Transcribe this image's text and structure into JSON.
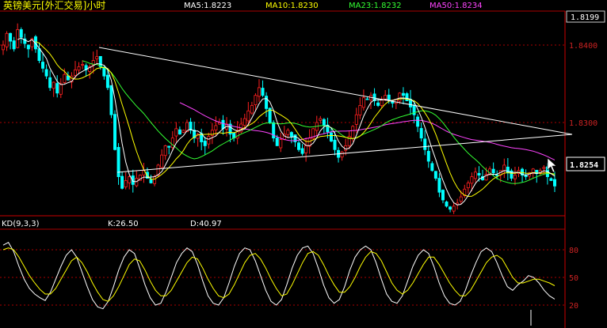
{
  "header": {
    "title": "英镑美元[外汇交易]小时",
    "ma_labels": [
      {
        "text": "MA5:1.8223",
        "color": "#ffffff"
      },
      {
        "text": "MA10:1.8230",
        "color": "#ffff00"
      },
      {
        "text": "MA23:1.8232",
        "color": "#33ff33"
      },
      {
        "text": "MA50:1.8234",
        "color": "#ff44ff"
      }
    ]
  },
  "price_axis": {
    "top_label": "1.8199",
    "ticks": [
      "1.8400",
      "1.8300"
    ],
    "current_price": "1.8254"
  },
  "kd_panel": {
    "title": "KD(9,3,3)",
    "k_label": "K:26.50",
    "d_label": "D:40.97",
    "ticks": [
      "80",
      "50",
      "20"
    ]
  },
  "colors": {
    "background": "#000000",
    "up_candle": "#ff2020",
    "down_candle": "#00ffff",
    "grid": "#aa0000",
    "axis_text": "#cc2222",
    "k_line": "#ffffff",
    "d_line": "#ffff00"
  },
  "icons": [
    "mouse-cursor-icon"
  ],
  "chart_data": [
    {
      "type": "candlestick",
      "title": "英镑美元[外汇交易]小时",
      "ylim": [
        1.8155,
        1.8455
      ],
      "yticks": [
        1.84,
        1.83
      ],
      "ma_values": {
        "MA5": 1.8223,
        "MA10": 1.823,
        "MA23": 1.8232,
        "MA50": 1.8234
      },
      "last_price": 1.8254,
      "close": [
        1.84,
        1.8415,
        1.8405,
        1.8395,
        1.842,
        1.841,
        1.8402,
        1.8395,
        1.8408,
        1.8395,
        1.838,
        1.837,
        1.836,
        1.8345,
        1.8352,
        1.8338,
        1.835,
        1.8362,
        1.8355,
        1.836,
        1.8368,
        1.8372,
        1.8375,
        1.8368,
        1.8372,
        1.838,
        1.8385,
        1.8372,
        1.836,
        1.8345,
        1.831,
        1.8265,
        1.823,
        1.8215,
        1.8225,
        1.823,
        1.822,
        1.8228,
        1.8232,
        1.8238,
        1.8228,
        1.8222,
        1.823,
        1.8245,
        1.8258,
        1.827,
        1.8268,
        1.828,
        1.8292,
        1.8285,
        1.829,
        1.83,
        1.829,
        1.828,
        1.8285,
        1.8275,
        1.827,
        1.8282,
        1.829,
        1.8296,
        1.83,
        1.8292,
        1.8298,
        1.8285,
        1.828,
        1.829,
        1.8298,
        1.8305,
        1.8315,
        1.8322,
        1.8335,
        1.8345,
        1.8335,
        1.8318,
        1.83,
        1.828,
        1.827,
        1.8278,
        1.8285,
        1.829,
        1.8282,
        1.8275,
        1.8265,
        1.826,
        1.827,
        1.828,
        1.8292,
        1.83,
        1.8305,
        1.8296,
        1.8288,
        1.8276,
        1.8265,
        1.8255,
        1.8262,
        1.827,
        1.8282,
        1.8295,
        1.831,
        1.8322,
        1.8332,
        1.833,
        1.8335,
        1.8328,
        1.8322,
        1.833,
        1.8335,
        1.833,
        1.8325,
        1.833,
        1.8338,
        1.8335,
        1.8328,
        1.832,
        1.831,
        1.8295,
        1.828,
        1.8265,
        1.825,
        1.8238,
        1.8228,
        1.821,
        1.82,
        1.8192,
        1.8188,
        1.8192,
        1.8196,
        1.8204,
        1.8214,
        1.8222,
        1.823,
        1.8236,
        1.8232,
        1.8226,
        1.8233,
        1.824,
        1.8235,
        1.8232,
        1.8238,
        1.8245,
        1.8235,
        1.8228,
        1.8232,
        1.8238,
        1.8232,
        1.823,
        1.8235,
        1.824,
        1.8234,
        1.8238,
        1.8242,
        1.823,
        1.8225,
        1.8218
      ]
    },
    {
      "type": "line",
      "title": "KD(9,3,3)",
      "ylim": [
        0,
        100
      ],
      "yticks": [
        80,
        50,
        20
      ],
      "series": [
        {
          "name": "K",
          "last": 26.5,
          "values": [
            85,
            88,
            78,
            62,
            48,
            38,
            32,
            28,
            25,
            34,
            48,
            62,
            74,
            80,
            72,
            56,
            40,
            26,
            18,
            16,
            24,
            40,
            58,
            72,
            80,
            76,
            60,
            42,
            28,
            20,
            22,
            34,
            50,
            66,
            76,
            82,
            78,
            64,
            46,
            30,
            22,
            20,
            28,
            44,
            62,
            76,
            82,
            80,
            68,
            52,
            36,
            24,
            20,
            26,
            42,
            60,
            74,
            82,
            84,
            76,
            60,
            42,
            28,
            22,
            26,
            40,
            58,
            72,
            80,
            84,
            80,
            66,
            48,
            32,
            24,
            22,
            30,
            46,
            62,
            74,
            80,
            76,
            62,
            44,
            30,
            22,
            20,
            24,
            36,
            52,
            66,
            78,
            82,
            78,
            66,
            52,
            40,
            36,
            42,
            46,
            52,
            50,
            44,
            36,
            30,
            26.5
          ]
        },
        {
          "name": "D",
          "last": 40.97,
          "values": [
            80,
            82,
            80,
            72,
            62,
            52,
            44,
            37,
            32,
            32,
            38,
            48,
            58,
            68,
            72,
            66,
            56,
            44,
            34,
            26,
            24,
            30,
            40,
            52,
            64,
            70,
            68,
            58,
            46,
            36,
            30,
            30,
            36,
            46,
            56,
            66,
            72,
            70,
            60,
            48,
            38,
            30,
            28,
            32,
            42,
            54,
            66,
            74,
            76,
            70,
            60,
            48,
            38,
            30,
            32,
            42,
            54,
            66,
            76,
            78,
            74,
            64,
            52,
            42,
            34,
            34,
            40,
            50,
            62,
            72,
            78,
            76,
            68,
            56,
            44,
            36,
            32,
            36,
            44,
            54,
            64,
            72,
            72,
            64,
            54,
            44,
            36,
            30,
            30,
            36,
            46,
            56,
            66,
            72,
            74,
            70,
            60,
            50,
            44,
            44,
            46,
            48,
            48,
            46,
            44,
            40.97
          ]
        }
      ]
    }
  ]
}
